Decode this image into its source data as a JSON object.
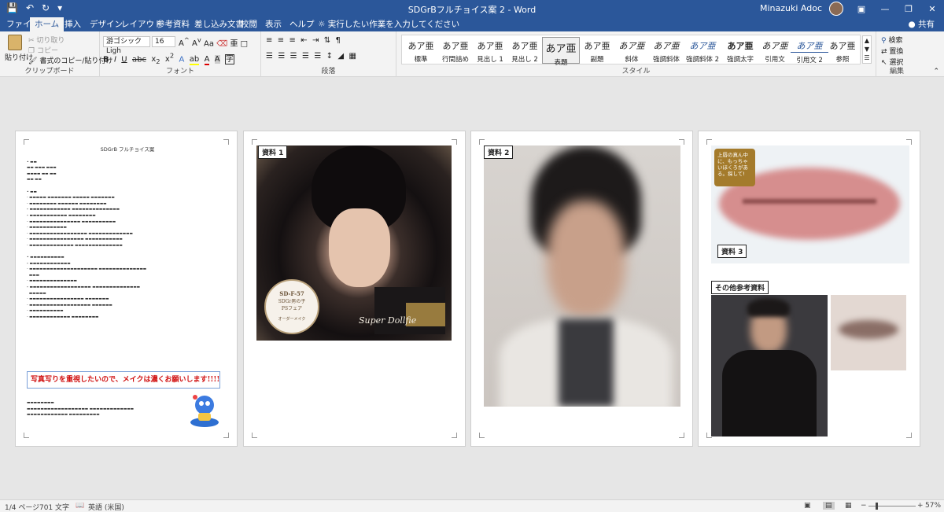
{
  "window": {
    "title": "SDGrBフルチョイス案 2 - Word",
    "user": "Minazuki Adoc"
  },
  "tabs": [
    {
      "label": "ファイル"
    },
    {
      "label": "ホーム"
    },
    {
      "label": "挿入"
    },
    {
      "label": "デザイン"
    },
    {
      "label": "レイアウト"
    },
    {
      "label": "参考資料"
    },
    {
      "label": "差し込み文書"
    },
    {
      "label": "校閲"
    },
    {
      "label": "表示"
    },
    {
      "label": "ヘルプ"
    }
  ],
  "tell_me": "実行したい作業を入力してください",
  "share": "共有",
  "clipboard": {
    "paste": "貼り付け",
    "cut": "切り取り",
    "copy": "コピー",
    "format_painter": "書式のコピー/貼り付け",
    "label": "クリップボード"
  },
  "font": {
    "name": "游ゴシック Ligh",
    "size": "16",
    "label": "フォント"
  },
  "paragraph": {
    "label": "段落"
  },
  "styles": {
    "label": "スタイル",
    "items": [
      {
        "sample": "あア亜",
        "name": "標準"
      },
      {
        "sample": "あア亜",
        "name": "行間詰め"
      },
      {
        "sample": "あア亜",
        "name": "見出し 1"
      },
      {
        "sample": "あア亜",
        "name": "見出し 2"
      },
      {
        "sample": "あア亜",
        "name": "表題"
      },
      {
        "sample": "あア亜",
        "name": "副題"
      },
      {
        "sample": "あア亜",
        "name": "斜体"
      },
      {
        "sample": "あア亜",
        "name": "強調斜体"
      },
      {
        "sample": "あア亜",
        "name": "強調斜体 2"
      },
      {
        "sample": "あア亜",
        "name": "強調太字"
      },
      {
        "sample": "あア亜",
        "name": "引用文"
      },
      {
        "sample": "あア亜",
        "name": "引用文 2"
      },
      {
        "sample": "あア亜",
        "name": "参照"
      }
    ]
  },
  "editing": {
    "label": "編集",
    "find": "検索",
    "replace": "置換",
    "select": "選択"
  },
  "page1": {
    "title": "SDGrB フルチョイス案",
    "red_notice": "写真写りを重視したいので、メイクは濃くお願いします!!!!!!!!!"
  },
  "page2": {
    "label": "資料 1",
    "badge_model": "SD-F-57",
    "badge_line1": "SDGr男の子",
    "badge_line2": "PSフェア",
    "badge_sub": "オーダーメイク",
    "watermark": "Super Dollfie"
  },
  "page3": {
    "label": "資料 2"
  },
  "page4": {
    "label": "資料 3",
    "other_label": "その他参考資料",
    "bubble": "上唇の真ん中に、もっちゃいほくろがある。探して!"
  },
  "status": {
    "page": "1/4 ページ",
    "words": "701 文字",
    "lang": "英語 (米国)",
    "zoom": "57%"
  },
  "colors": {
    "brand": "#2b579a",
    "notice_red": "#d01010"
  }
}
